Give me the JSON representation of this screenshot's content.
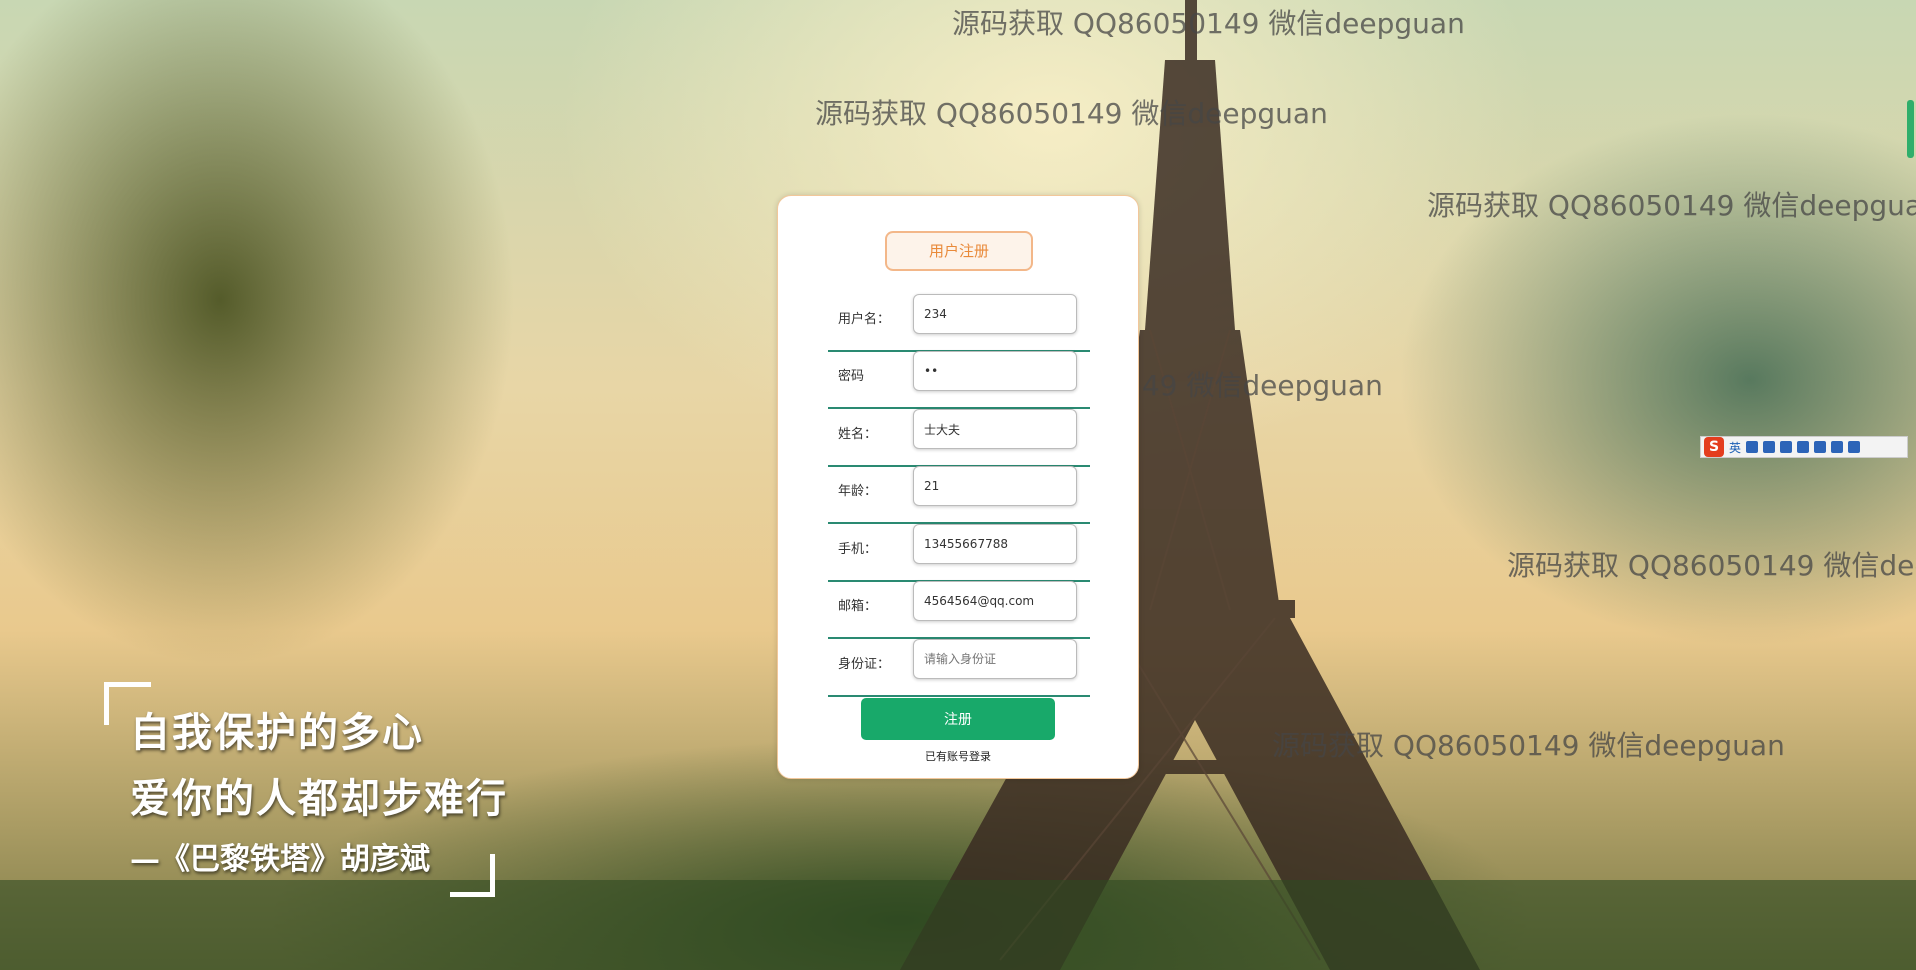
{
  "watermark_text": "源码获取 QQ86050149 微信deepguan",
  "form": {
    "title": "用户注册",
    "fields": [
      {
        "label": "用户名：",
        "value": "234",
        "placeholder": ""
      },
      {
        "label": "密码",
        "value": "••",
        "placeholder": ""
      },
      {
        "label": "姓名：",
        "value": "士大夫",
        "placeholder": ""
      },
      {
        "label": "年龄：",
        "value": "21",
        "placeholder": ""
      },
      {
        "label": "手机：",
        "value": "13455667788",
        "placeholder": ""
      },
      {
        "label": "邮箱：",
        "value": "4564564@qq.com",
        "placeholder": ""
      },
      {
        "label": "身份证：",
        "value": "",
        "placeholder": "请输入身份证"
      }
    ],
    "submit_label": "注册",
    "login_link": "已有账号登录"
  },
  "poem": {
    "line1": "自我保护的多心",
    "line2": "爱你的人都却步难行",
    "author": "—《巴黎铁塔》胡彦斌"
  },
  "ime": {
    "logo": "S",
    "lang": "英"
  },
  "colors": {
    "accent_orange": "#e98a3a",
    "button_green": "#18a96a",
    "divider_teal": "#2a8a72"
  }
}
